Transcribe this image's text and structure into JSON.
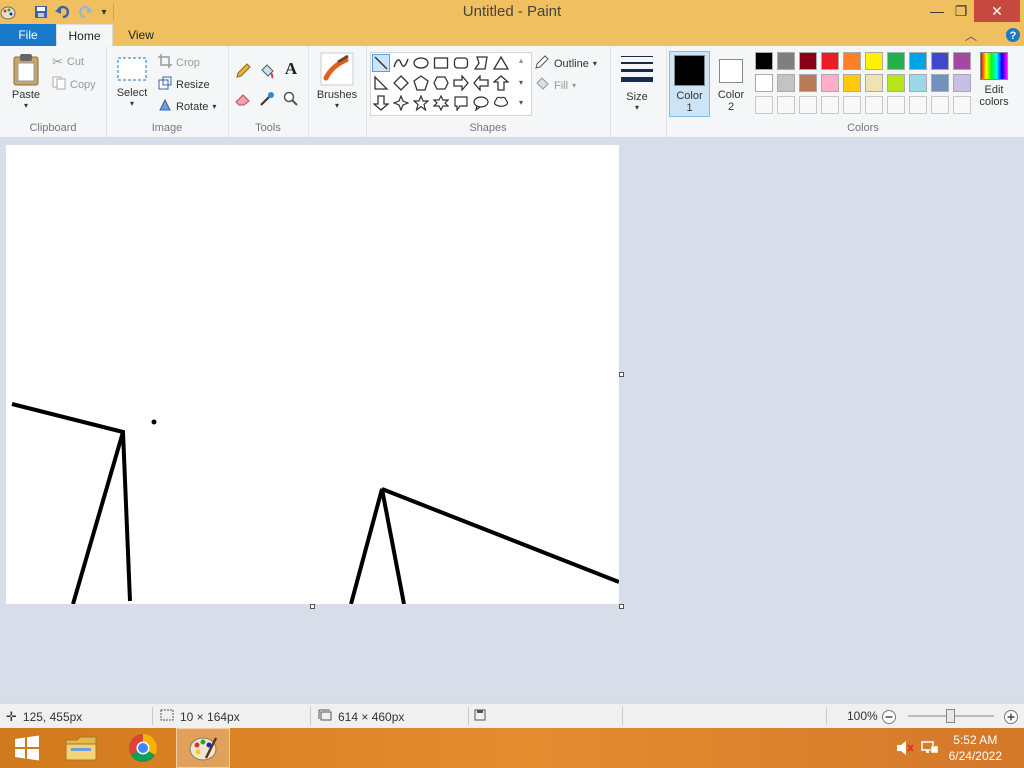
{
  "window": {
    "title": "Untitled - Paint",
    "minimize": "—",
    "restore": "❐",
    "close": "✕"
  },
  "tabs": {
    "file": "File",
    "home": "Home",
    "view": "View"
  },
  "ribbon": {
    "clipboard": {
      "label": "Clipboard",
      "paste": "Paste",
      "cut": "Cut",
      "copy": "Copy"
    },
    "image": {
      "label": "Image",
      "select": "Select",
      "crop": "Crop",
      "resize": "Resize",
      "rotate": "Rotate"
    },
    "tools": {
      "label": "Tools"
    },
    "brushes": "Brushes",
    "shapes": {
      "label": "Shapes",
      "outline": "Outline",
      "fill": "Fill"
    },
    "size": "Size",
    "color1": "Color",
    "color1_num": "1",
    "color2": "Color",
    "color2_num": "2",
    "colors": {
      "label": "Colors",
      "edit": "Edit",
      "edit2": "colors",
      "row1": [
        "#000000",
        "#7f7f7f",
        "#880015",
        "#ed1c24",
        "#ff7f27",
        "#fff200",
        "#22b14c",
        "#00a2e8",
        "#3f48cc",
        "#a349a4"
      ],
      "row2": [
        "#ffffff",
        "#c3c3c3",
        "#b97a57",
        "#ffaec9",
        "#ffc90e",
        "#efe4b0",
        "#b5e61d",
        "#99d9ea",
        "#7092be",
        "#c8bfe7"
      ]
    }
  },
  "status": {
    "cursor": "125, 455px",
    "selection": "10 × 164px",
    "canvas_size": "614 × 460px",
    "zoom": "100%"
  },
  "clock": {
    "time": "5:52 AM",
    "date": "6/24/2022"
  }
}
